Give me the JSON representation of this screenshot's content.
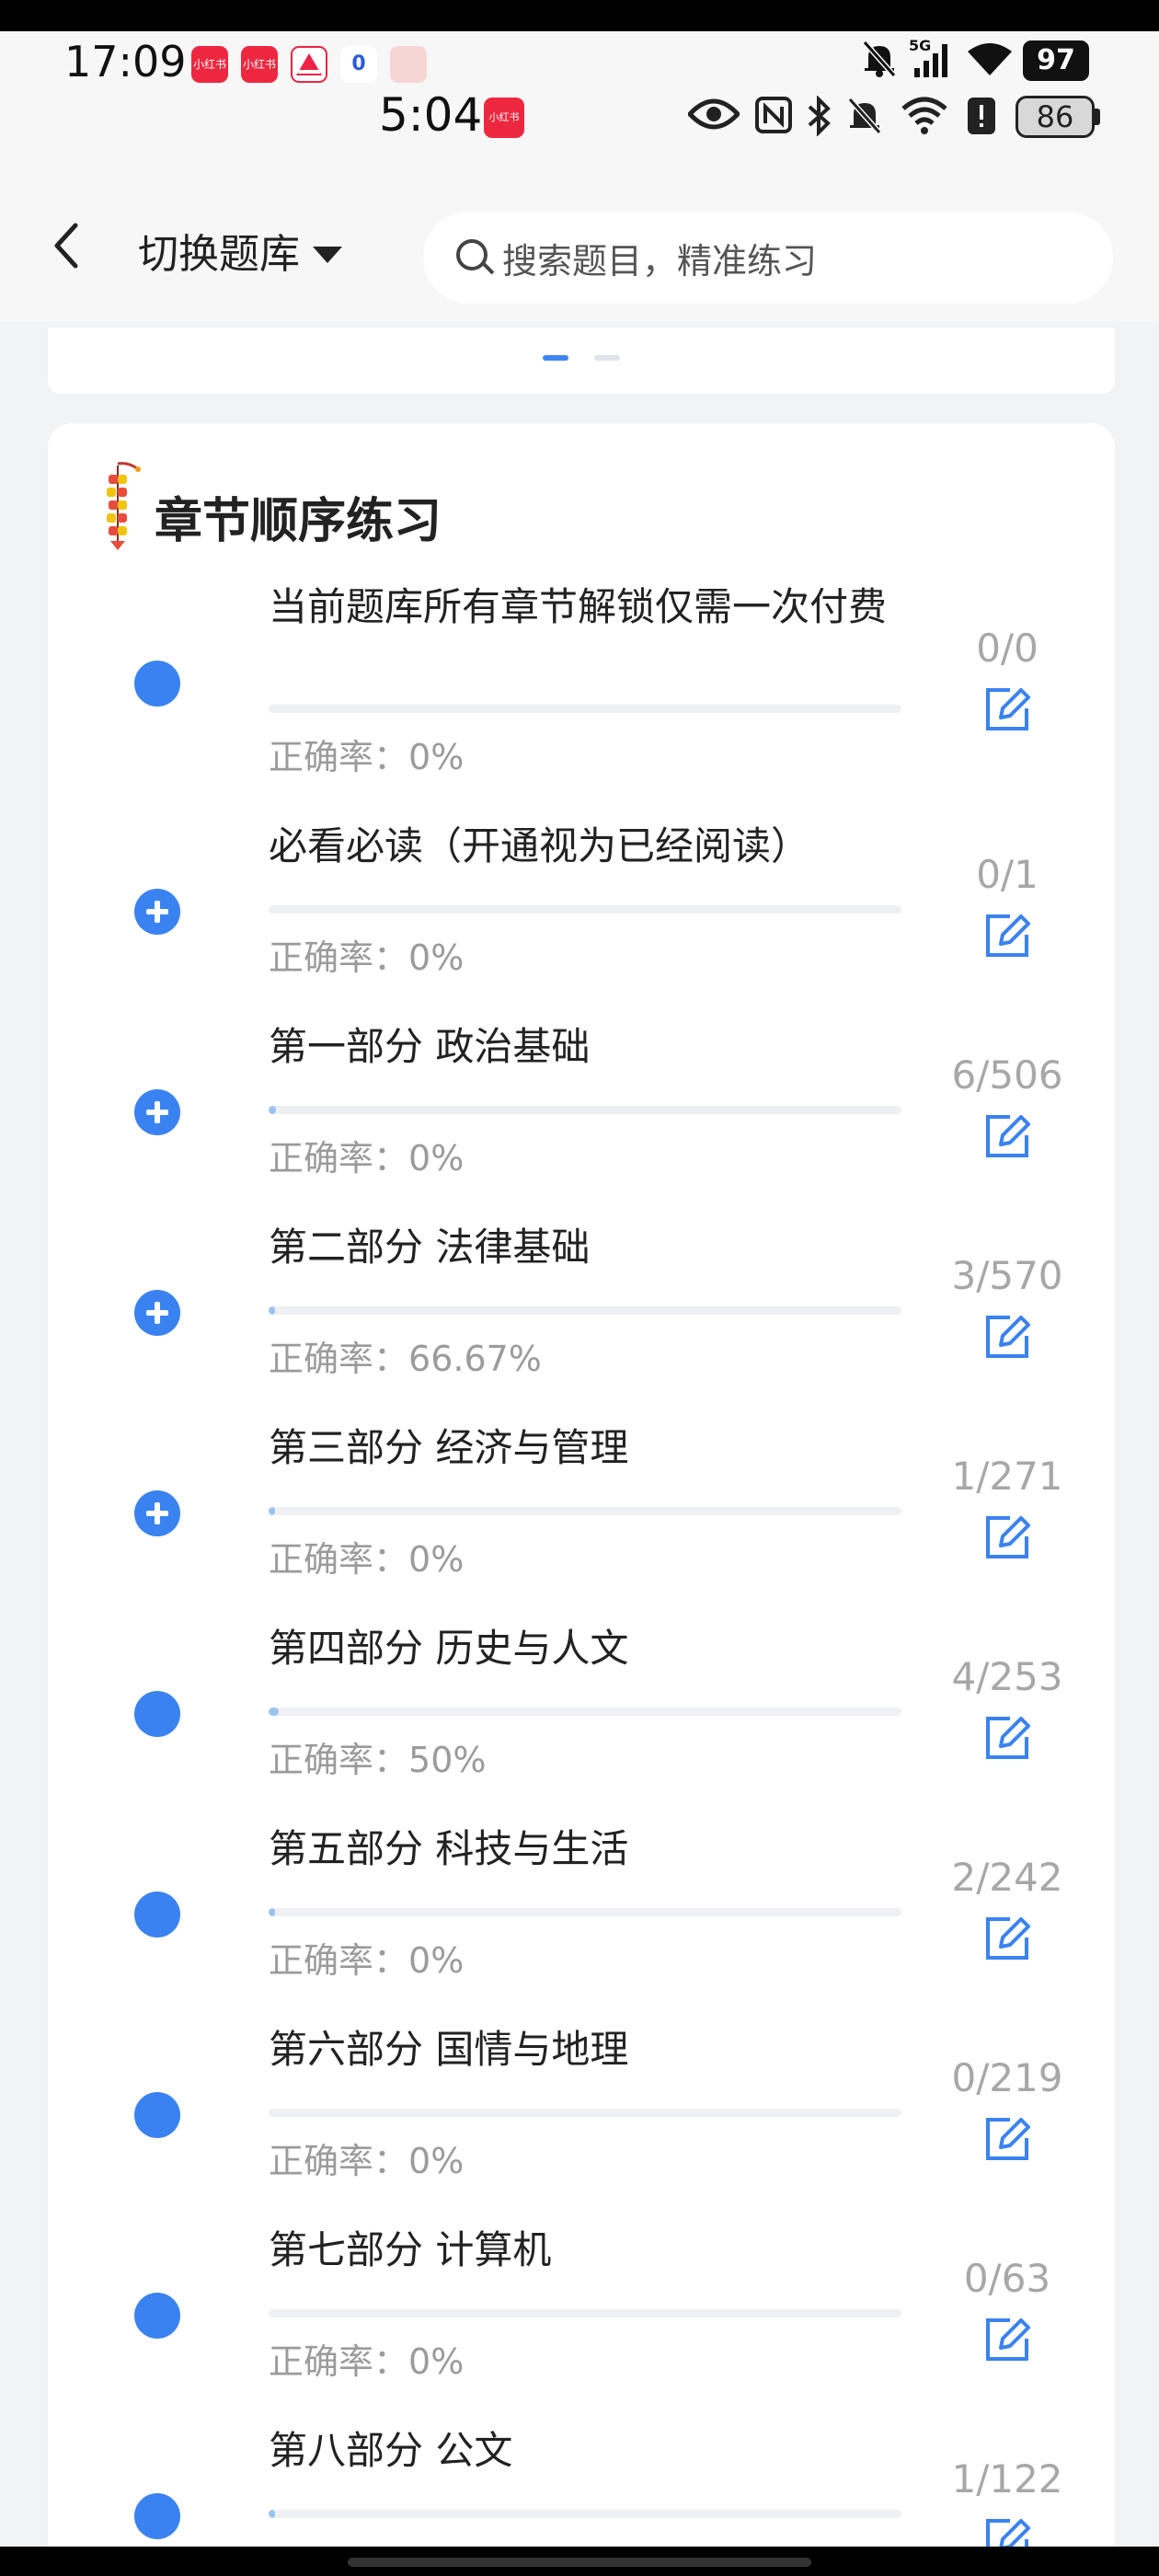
{
  "outer_status": {
    "time": "17:09",
    "apps": [
      "小红书",
      "小红书",
      "",
      "0",
      "米家"
    ],
    "network": "5G",
    "battery": "97"
  },
  "inner_status": {
    "time": "5:04",
    "badge": "小红书",
    "battery": "86"
  },
  "nav": {
    "back_icon": "chevron-left-icon",
    "switch_label": "切换题库",
    "search_placeholder": "搜索题目，精准练习"
  },
  "section": {
    "title": "章节顺序练习"
  },
  "accuracy_label": "正确率：",
  "chapters": [
    {
      "title": "当前题库所有章节解锁仅需一次付费",
      "accuracy": "0%",
      "count": "0/0",
      "progress": 0,
      "expandable": false
    },
    {
      "title": "必看必读（开通视为已经阅读）",
      "accuracy": "0%",
      "count": "0/1",
      "progress": 0,
      "expandable": true
    },
    {
      "title": "第一部分 政治基础",
      "accuracy": "0%",
      "count": "6/506",
      "progress": 0.012,
      "expandable": true
    },
    {
      "title": "第二部分 法律基础",
      "accuracy": "66.67%",
      "count": "3/570",
      "progress": 0.005,
      "expandable": true
    },
    {
      "title": "第三部分 经济与管理",
      "accuracy": "0%",
      "count": "1/271",
      "progress": 0.004,
      "expandable": true
    },
    {
      "title": "第四部分 历史与人文",
      "accuracy": "50%",
      "count": "4/253",
      "progress": 0.016,
      "expandable": false
    },
    {
      "title": "第五部分 科技与生活",
      "accuracy": "0%",
      "count": "2/242",
      "progress": 0.008,
      "expandable": false
    },
    {
      "title": "第六部分 国情与地理",
      "accuracy": "0%",
      "count": "0/219",
      "progress": 0,
      "expandable": false
    },
    {
      "title": "第七部分 计算机",
      "accuracy": "0%",
      "count": "0/63",
      "progress": 0,
      "expandable": false
    },
    {
      "title": "第八部分 公文",
      "accuracy": "",
      "count": "1/122",
      "progress": 0.008,
      "expandable": false
    }
  ],
  "colors": {
    "accent": "#3a82f0",
    "progress_fill": "#9cc3f0",
    "muted_text": "#9b9b9b",
    "background": "#f2f3f5"
  }
}
